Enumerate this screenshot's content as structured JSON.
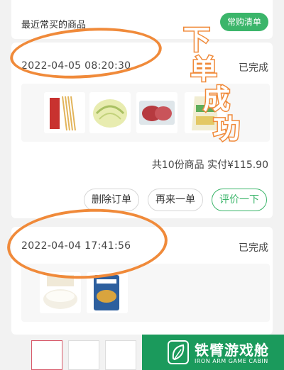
{
  "header": {
    "title": "最近常买的商品",
    "list_button": "常购清单"
  },
  "orders": [
    {
      "datetime": "2022-04-05 08:20:30",
      "status": "已完成",
      "product_icons": [
        "pasta-thumb-icon",
        "cabbage-thumb-icon",
        "meat-thumb-icon",
        "rice-bag-thumb-icon"
      ],
      "summary_count": "共10份商品",
      "summary_paid_label": "实付",
      "summary_amount": "¥115.90",
      "actions": {
        "delete": "删除订单",
        "reorder": "再来一单",
        "review": "评价一下"
      }
    },
    {
      "datetime": "2022-04-04 17:41:56",
      "status": "已完成",
      "product_icons": [
        "rice-bowl-thumb-icon",
        "snack-bag-thumb-icon"
      ]
    }
  ],
  "annotation": {
    "text": [
      "下",
      "单",
      "成",
      "功"
    ]
  },
  "watermark": {
    "name_cn": "铁臂游戏舱",
    "name_en": "IRON ARM GAME CABIN"
  },
  "colors": {
    "brand_green": "#3bb56a",
    "annotation_orange": "#f08a3a",
    "watermark_green": "#1b9a5c"
  }
}
